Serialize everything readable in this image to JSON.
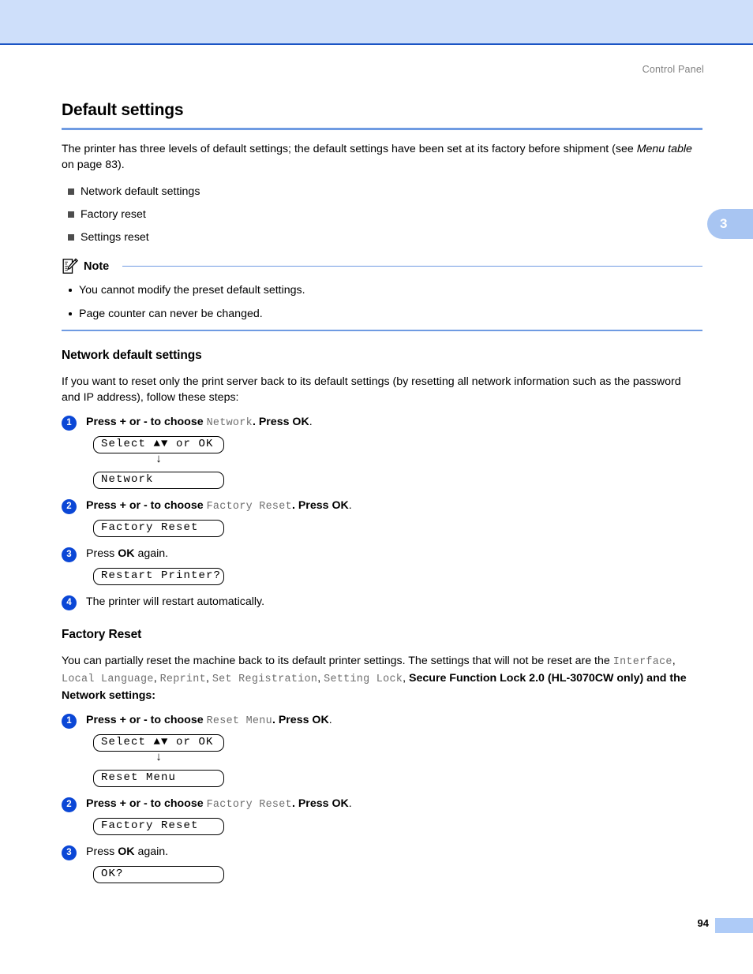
{
  "header": {
    "running_title": "Control Panel",
    "chapter_tab": "3"
  },
  "page": {
    "title": "Default settings",
    "intro_before_italic": "The printer has three levels of default settings; the default settings have been set at its factory before shipment (see ",
    "intro_italic": "Menu table",
    "intro_after_italic": " on page 83).",
    "bullets": [
      "Network default settings",
      "Factory reset",
      "Settings reset"
    ]
  },
  "note": {
    "label": "Note",
    "items": [
      "You cannot modify the preset default settings.",
      "Page counter can never be changed."
    ]
  },
  "network_section": {
    "heading": "Network default settings",
    "intro": "If you want to reset only the print server back to its default settings (by resetting all network information such as the password and IP address), follow these steps:",
    "steps": [
      {
        "num": "1",
        "text_a": "Press + or - to choose ",
        "mono": "Network",
        "text_b": ". Press ",
        "bold": "OK",
        "text_c": "."
      },
      {
        "num": "2",
        "text_a": "Press + or - to choose ",
        "mono": "Factory Reset",
        "text_b": ". Press ",
        "bold": "OK",
        "text_c": "."
      },
      {
        "num": "3",
        "text_a": "Press ",
        "bold": "OK",
        "text_c": " again."
      },
      {
        "num": "4",
        "text_a": "The printer will restart automatically."
      }
    ],
    "lcd_select": "Select ▲▼ or OK",
    "lcd_network": "Network",
    "lcd_factory_reset": "Factory Reset",
    "lcd_restart": "Restart Printer?",
    "arrow": "↓"
  },
  "factory_section": {
    "heading": "Factory Reset",
    "intro_a": "You can partially reset the machine back to its default printer settings. The settings that will not be reset are the ",
    "mono_terms": [
      "Interface",
      "Local Language",
      "Reprint",
      "Set Registration",
      "Setting Lock"
    ],
    "intro_b": "Secure Function Lock 2.0 (HL-3070CW only) and the Network settings:",
    "steps": [
      {
        "num": "1",
        "text_a": "Press + or - to choose ",
        "mono": "Reset Menu",
        "text_b": ". Press ",
        "bold": "OK",
        "text_c": "."
      },
      {
        "num": "2",
        "text_a": "Press + or - to choose ",
        "mono": "Factory Reset",
        "text_b": ". Press ",
        "bold": "OK",
        "text_c": "."
      },
      {
        "num": "3",
        "text_a": "Press ",
        "bold": "OK",
        "text_c": " again."
      }
    ],
    "lcd_select": "Select ▲▼ or OK",
    "lcd_reset_menu": "Reset Menu",
    "lcd_factory_reset": "Factory Reset",
    "lcd_ok": "OK?",
    "arrow": "↓"
  },
  "footer": {
    "page_number": "94"
  },
  "colors": {
    "band": "#cedffa",
    "band_border": "#1b54c4",
    "rule_blue": "#6f9be2",
    "step_circle": "#0b47d6",
    "tab_blue": "#a8c5f2",
    "mono_gray": "#6e6e6e"
  }
}
